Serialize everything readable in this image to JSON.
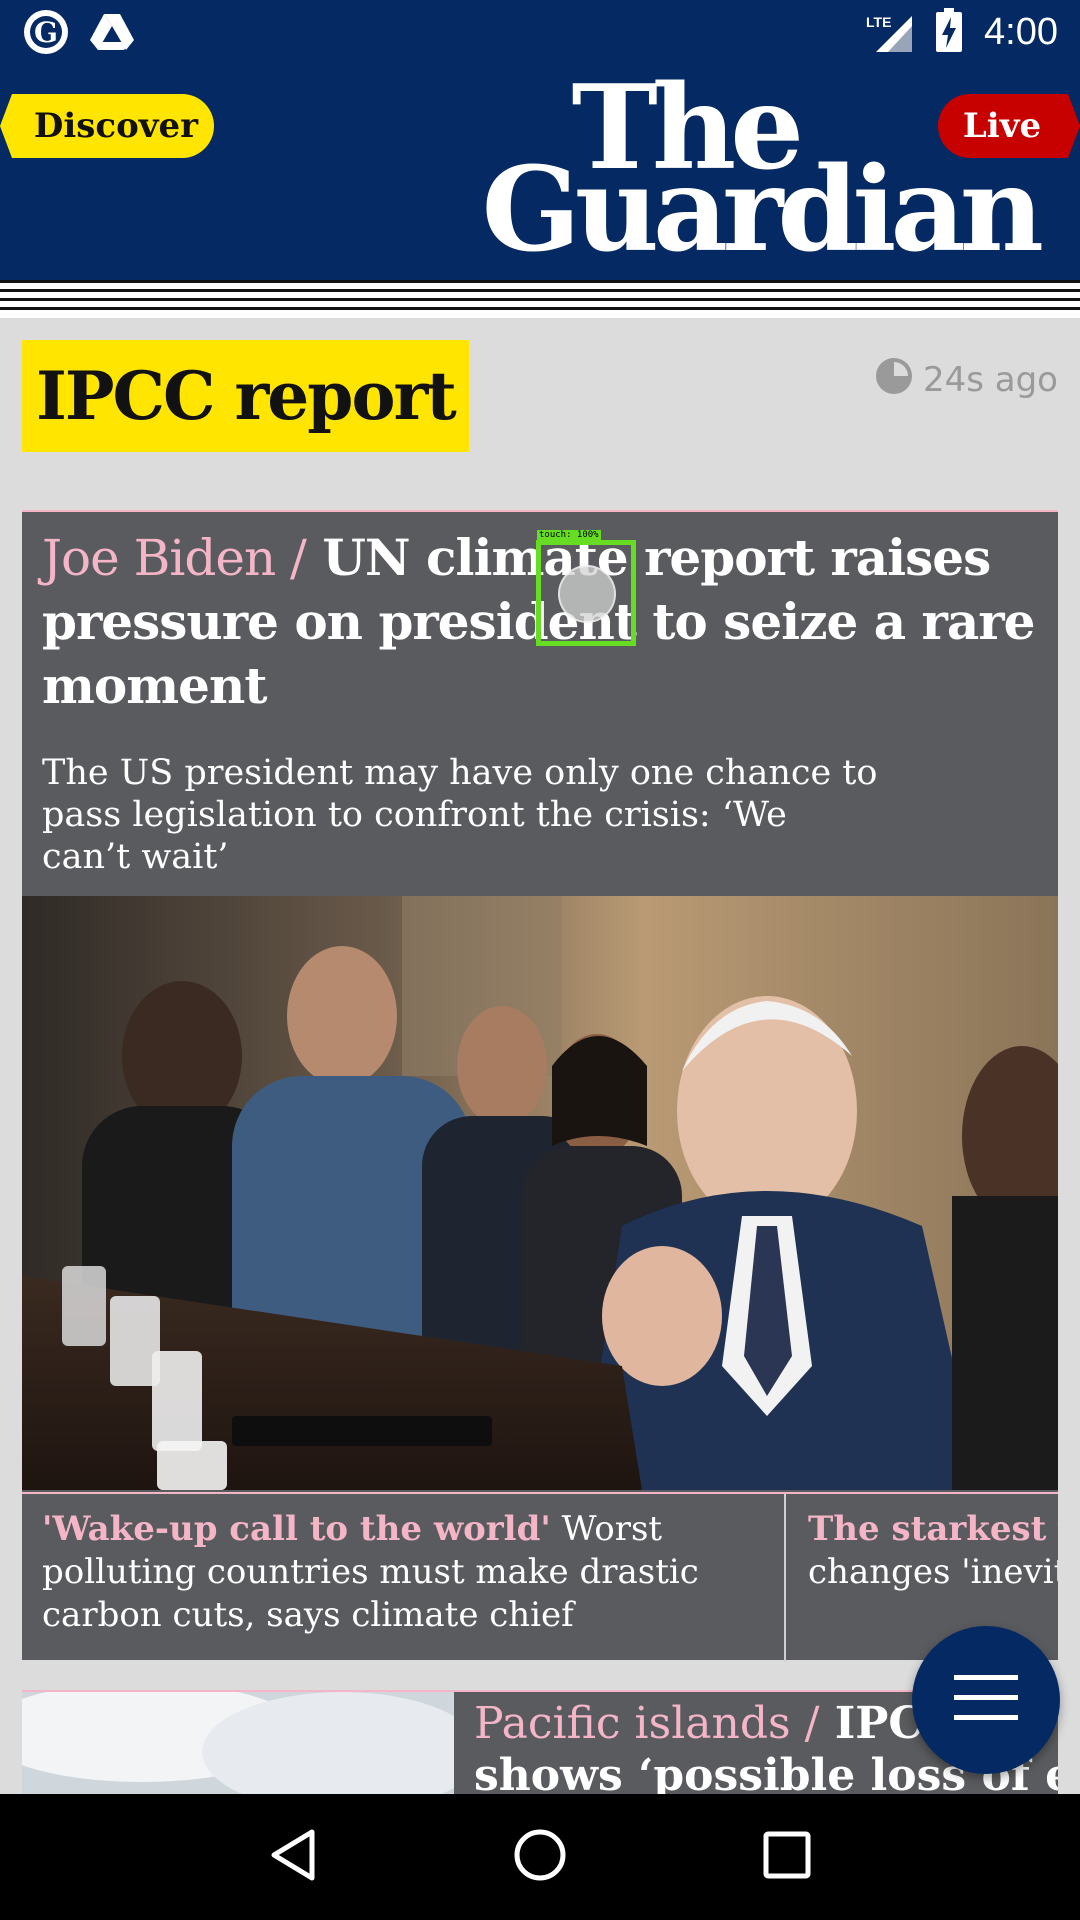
{
  "status_bar": {
    "time": "4:00",
    "network": "LTE",
    "icons": [
      "guardian-app-icon",
      "drive-icon",
      "signal-icon",
      "battery-charging-icon"
    ]
  },
  "header": {
    "discover_label": "Discover",
    "live_label": "Live",
    "logo_line1": "The",
    "logo_line2": "Guardian"
  },
  "section": {
    "title": "IPCC report",
    "timestamp": "24s ago"
  },
  "main_story": {
    "kicker": "Joe Biden /",
    "headline": " UN climate report raises pressure on president to seize a rare moment",
    "standfirst": "The US president may have only one chance to pass legislation to confront the crisis: ‘We can’t wait’"
  },
  "sub_stories": [
    {
      "kicker": "'Wake-up call to the world'",
      "headline": " Worst polluting countries must make drastic carbon cuts, says climate chief"
    },
    {
      "kicker": "The starkest w",
      "headline": "changes 'inevita"
    }
  ],
  "second_story": {
    "kicker": "Pacific islands /",
    "headline_line1": " IPCC re",
    "headline_line2": "shows ‘possible loss of entire"
  },
  "touch_indicator": {
    "label": "touch: 100%"
  },
  "colors": {
    "brand_navy": "#052962",
    "yellow": "#ffe500",
    "live_red": "#c70000",
    "kicker_pink": "#f4b5c7",
    "card_gray": "#5a5b5e"
  }
}
